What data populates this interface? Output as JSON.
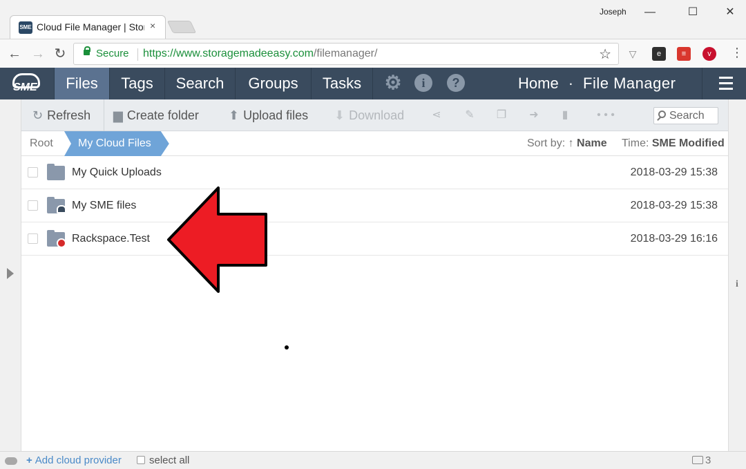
{
  "browser": {
    "tab_title": "Cloud File Manager | Stor",
    "tab_close": "×",
    "favicon_text": "SME",
    "profile_name": "Joseph",
    "window_controls": {
      "minimize": "—",
      "maximize": "☐",
      "close": "✕"
    },
    "secure_label": "Secure",
    "url_base": "https://www.storagemadeeasy.com",
    "url_path": "/filemanager/",
    "nav": {
      "back": "←",
      "forward": "→",
      "reload": "↻"
    }
  },
  "app_nav": {
    "logo_text": "SME",
    "tabs": [
      {
        "label": "Files",
        "active": true
      },
      {
        "label": "Tags",
        "active": false
      },
      {
        "label": "Search",
        "active": false
      },
      {
        "label": "Groups",
        "active": false
      },
      {
        "label": "Tasks",
        "active": false
      }
    ],
    "icons": {
      "gear": "⚙",
      "info": "i",
      "help": "?"
    },
    "breadcrumb": {
      "home": "Home",
      "separator": "·",
      "current": "File Manager"
    }
  },
  "toolbar": {
    "refresh": "Refresh",
    "create_folder": "Create folder",
    "upload_files": "Upload files",
    "download": "Download",
    "more": "• • •",
    "search_placeholder": "Search"
  },
  "crumbs": {
    "root": "Root",
    "current": "My Cloud Files",
    "sort_label": "Sort by: ↑",
    "sort_value": "Name",
    "time_label": "Time:",
    "time_value": "SME Modified"
  },
  "files": [
    {
      "name": "My Quick Uploads",
      "date": "2018-03-29 15:38",
      "badge": "none"
    },
    {
      "name": "My SME files",
      "date": "2018-03-29 15:38",
      "badge": "sme"
    },
    {
      "name": "Rackspace.Test",
      "date": "2018-03-29 16:16",
      "badge": "rackspace"
    }
  ],
  "status": {
    "add_provider": "Add cloud provider",
    "add_plus": "+",
    "select_all": "select all",
    "folder_count": "3"
  },
  "colors": {
    "nav_bg": "#3a4b5e",
    "nav_active": "#5b7290",
    "crumb_active": "#6fa4d8",
    "secure_green": "#1a8f3a",
    "arrow_red": "#ed1c24"
  }
}
